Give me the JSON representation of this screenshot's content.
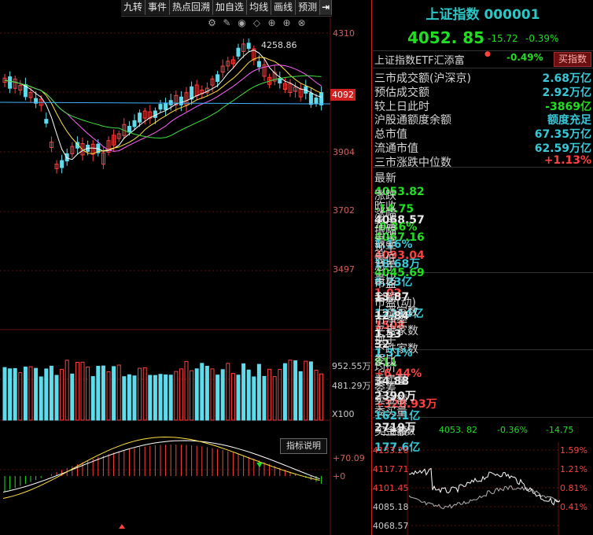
{
  "tabs": [
    "九转",
    "事件",
    "热点回溯",
    "加自选",
    "均线",
    "画线",
    "预测"
  ],
  "tab_arrow": "⇥",
  "tool_icons": [
    "gear-icon",
    "pencil-icon",
    "eye-icon",
    "diamond-icon",
    "add-icon",
    "zoom-in-icon",
    "close-icon"
  ],
  "chart": {
    "price_axis": [
      "4310",
      "4092",
      "3904",
      "3702",
      "3497"
    ],
    "current_price_tag": "4092",
    "high_label": "4258.86",
    "volume_axis": [
      "952.55万",
      "481.29万",
      "X100"
    ],
    "macd_axis": [
      "+70.09",
      "+0"
    ],
    "indicator_button": "指标说明"
  },
  "quote": {
    "name": "上证指数 000001",
    "price": "4052. 85",
    "change": "-15.72",
    "change_pct": "-0.39%",
    "etf_name": "上证指数ETF汇添富",
    "etf_pct": "-0.49%",
    "etf_button": "买指数",
    "stats": [
      {
        "k": "三市成交额(沪深京)",
        "v": "2.68万亿",
        "cls": "c"
      },
      {
        "k": "预估成交额",
        "v": "2.92万亿",
        "cls": "c"
      },
      {
        "k": "较上日此时",
        "v": "-3869亿",
        "cls": "g"
      },
      {
        "k": "沪股通额度余额",
        "v": "额度充足",
        "cls": "c"
      },
      {
        "k": "总市值",
        "v": "67.35万亿",
        "cls": "c"
      },
      {
        "k": "流通市值",
        "v": "62.59万亿",
        "cls": "c"
      },
      {
        "k": "三市涨跌中位数",
        "v": "+1.13%",
        "cls": "r"
      }
    ],
    "grid1": [
      [
        "最新",
        "4053.82",
        "g",
        "昨收",
        "4068.57",
        "w"
      ],
      [
        "涨跌",
        "-14.75",
        "g",
        "开盘",
        "4067.16",
        "g"
      ],
      [
        "涨幅",
        "-0.36%",
        "g",
        "最高",
        "4093.04",
        "r"
      ],
      [
        "振幅",
        "1.16%",
        "c",
        "最低",
        "4045.69",
        "g"
      ],
      [
        "现手",
        "18.68万",
        "c",
        "量比",
        "1.02",
        "r"
      ],
      [
        "总手",
        "6.23亿",
        "c",
        "金额",
        "12214亿",
        "c"
      ]
    ],
    "grid2": [
      [
        "市盈",
        "13.87",
        "w",
        "上涨家数",
        "1508",
        "r"
      ],
      [
        "市盈(动)",
        "12.84",
        "w",
        "平盘家数",
        "32",
        "w"
      ],
      [
        "市净率",
        "1.53",
        "w",
        "下跌家数",
        "811",
        "g"
      ],
      [
        "换手",
        "1.31%",
        "c",
        "均价",
        "34.88",
        "w"
      ]
    ],
    "grid3": [
      [
        "委比",
        "+6.44%",
        "r",
        "委差",
        "+328.93万",
        "r"
      ],
      [
        "委卖量",
        "2390万",
        "w",
        "委买量",
        "2719万",
        "w"
      ],
      [
        "卖金额",
        "162.1亿",
        "c",
        "买金额",
        "177.6亿",
        "c"
      ]
    ],
    "mini": {
      "name": "上证指数",
      "price": "4053. 82",
      "pct": "-0.36%",
      "chg": "-14.75",
      "left_axis": [
        "4133.26",
        "4117.71",
        "4101.45",
        "4085.18",
        "4068.57"
      ],
      "right_axis": [
        "1.59%",
        "1.21%",
        "0.81%",
        "0.41%"
      ]
    }
  },
  "colors": {
    "up": "#ff4040",
    "down": "#22dd22",
    "accent": "#29c7c7"
  }
}
